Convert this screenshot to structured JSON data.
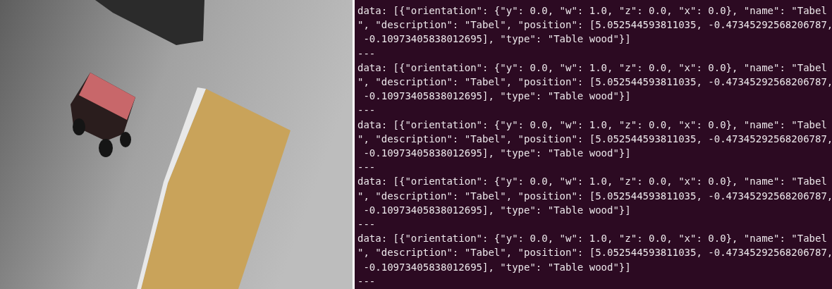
{
  "terminal": {
    "lines": [
      "data: [{\"orientation\": {\"y\": 0.0, \"w\": 1.0, \"z\": 0.0, \"x\": 0.0}, \"name\": \"Tabel",
      "\", \"description\": \"Tabel\", \"position\": [5.052544593811035, -0.47345292568206787,",
      " -0.10973405838012695], \"type\": \"Table wood\"}]",
      "---",
      "data: [{\"orientation\": {\"y\": 0.0, \"w\": 1.0, \"z\": 0.0, \"x\": 0.0}, \"name\": \"Tabel",
      "\", \"description\": \"Tabel\", \"position\": [5.052544593811035, -0.47345292568206787,",
      " -0.10973405838012695], \"type\": \"Table wood\"}]",
      "---",
      "data: [{\"orientation\": {\"y\": 0.0, \"w\": 1.0, \"z\": 0.0, \"x\": 0.0}, \"name\": \"Tabel",
      "\", \"description\": \"Tabel\", \"position\": [5.052544593811035, -0.47345292568206787,",
      " -0.10973405838012695], \"type\": \"Table wood\"}]",
      "---",
      "data: [{\"orientation\": {\"y\": 0.0, \"w\": 1.0, \"z\": 0.0, \"x\": 0.0}, \"name\": \"Tabel",
      "\", \"description\": \"Tabel\", \"position\": [5.052544593811035, -0.47345292568206787,",
      " -0.10973405838012695], \"type\": \"Table wood\"}]",
      "---",
      "data: [{\"orientation\": {\"y\": 0.0, \"w\": 1.0, \"z\": 0.0, \"x\": 0.0}, \"name\": \"Tabel",
      "\", \"description\": \"Tabel\", \"position\": [5.052544593811035, -0.47345292568206787,",
      " -0.10973405838012695], \"type\": \"Table wood\"}]",
      "---"
    ]
  }
}
